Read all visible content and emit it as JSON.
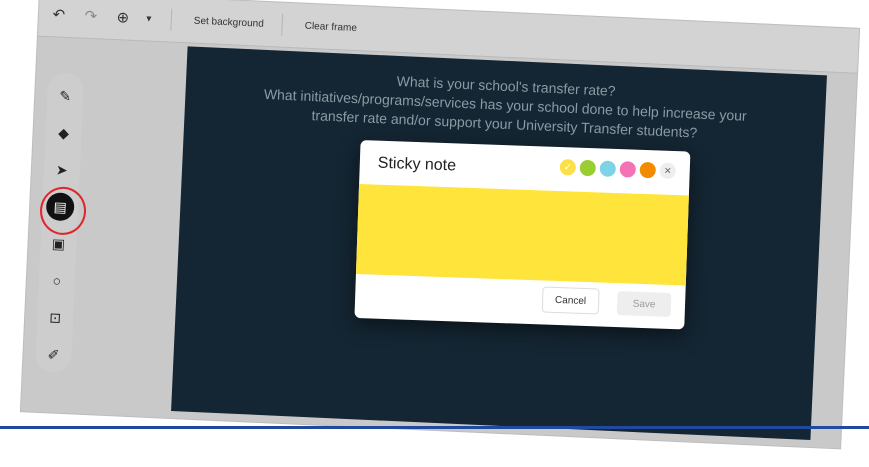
{
  "toolbar": {
    "undo_icon": "undo-icon",
    "redo_icon": "redo-icon",
    "zoom_icon": "zoom-in-icon",
    "zoom_caret": "▾",
    "set_background_label": "Set background",
    "clear_frame_label": "Clear frame"
  },
  "left_rail": {
    "tools": [
      {
        "name": "pen",
        "icon": "pen-icon",
        "glyph": "✎"
      },
      {
        "name": "eraser",
        "icon": "eraser-icon",
        "glyph": "◆"
      },
      {
        "name": "select",
        "icon": "pointer-icon",
        "glyph": "➤"
      },
      {
        "name": "sticky-note",
        "icon": "sticky-note-icon",
        "glyph": "▤"
      },
      {
        "name": "image",
        "icon": "image-icon",
        "glyph": "▣"
      },
      {
        "name": "shape",
        "icon": "circle-icon",
        "glyph": "○"
      },
      {
        "name": "text-box",
        "icon": "text-box-icon",
        "glyph": "⊡"
      },
      {
        "name": "laser",
        "icon": "laser-icon",
        "glyph": "✐"
      }
    ]
  },
  "frame": {
    "prompt": "What is your school's transfer rate?\nWhat initiatives/programs/services has your school done to help increase your\ntransfer rate and/or support your University Transfer students?"
  },
  "dialog": {
    "title": "Sticky note",
    "colors": [
      "#fde047",
      "#9acd32",
      "#7fd3e6",
      "#f472b6",
      "#f28b00"
    ],
    "selected_color": "#fde047",
    "cancel_label": "Cancel",
    "save_label": "Save"
  },
  "annotation": {
    "highlight_color": "#e0262d",
    "accent_line_color": "#1f4aa0"
  }
}
